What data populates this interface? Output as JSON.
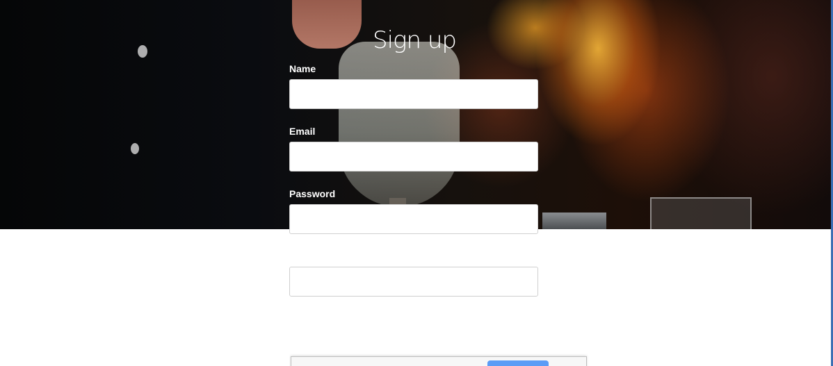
{
  "form": {
    "title": "Sign up",
    "fields": [
      {
        "label": "Name",
        "value": "",
        "placeholder": ""
      },
      {
        "label": "Email",
        "value": "",
        "placeholder": ""
      },
      {
        "label": "Password",
        "value": "",
        "placeholder": ""
      }
    ],
    "extra_field": {
      "value": "",
      "placeholder": ""
    }
  },
  "colors": {
    "title_text": "#ffffff",
    "input_border": "#cfcfcf",
    "dialog_button": "#5b9cf6",
    "page_background": "#ffffff"
  }
}
